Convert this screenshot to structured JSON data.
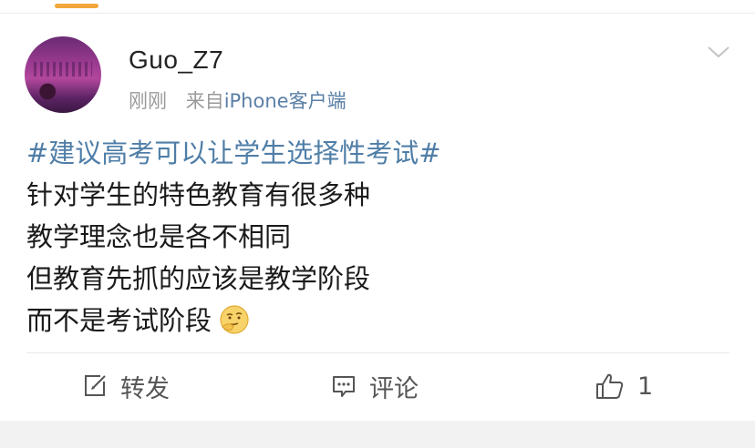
{
  "post": {
    "username": "Guo_Z7",
    "time": "刚刚",
    "source_prefix": "来自",
    "source_device": "iPhone客户端",
    "lines": [
      "#建议高考可以让学生选择性考试#",
      "针对学生的特色教育有很多种",
      "教学理念也是各不相同",
      "但教育先抓的应该是教学阶段",
      "而不是考试阶段"
    ],
    "emoji": "thinking-face"
  },
  "actions": {
    "repost_label": "转发",
    "comment_label": "评论",
    "like_count": "1"
  },
  "icons": {
    "repost": "repost-icon",
    "comment": "comment-icon",
    "like": "thumbs-up-icon",
    "menu": "chevron-down-icon"
  },
  "colors": {
    "hashtag": "#4f7ea7",
    "source_device": "#5a7fa6",
    "tab_indicator": "#f1a73b"
  }
}
